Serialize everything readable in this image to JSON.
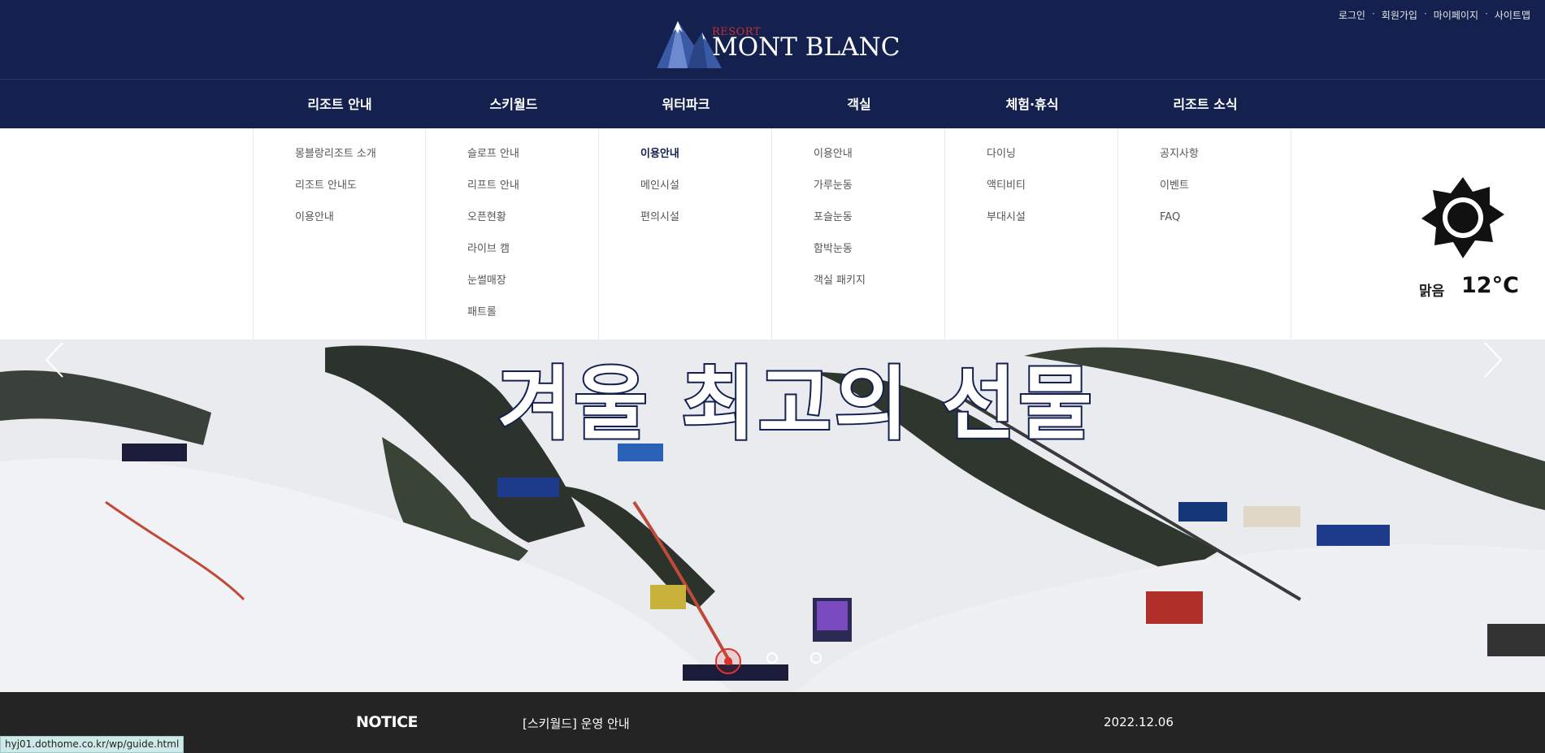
{
  "util_links": [
    "로그인",
    "회원가입",
    "마이페이지",
    "사이트맵"
  ],
  "logo": {
    "small": "RESORT",
    "big": "MONT BLANC",
    "alt_label": "Resort Mont Blanc"
  },
  "gnb": [
    "리조트 안내",
    "스키월드",
    "워터파크",
    "객실",
    "체험·휴식",
    "리조트 소식"
  ],
  "mega": [
    [
      "몽블랑리조트 소개",
      "리조트 안내도",
      "이용안내"
    ],
    [
      "슬로프 안내",
      "리프트 안내",
      "오픈현황",
      "라이브 캠",
      "눈썰매장",
      "패트롤"
    ],
    [
      "이용안내",
      "메인시설",
      "편의시설"
    ],
    [
      "이용안내",
      "가루눈동",
      "포슬눈동",
      "함박눈동",
      "객실 패키지"
    ],
    [
      "다이닝",
      "액티비티",
      "부대시설"
    ],
    [
      "공지사항",
      "이벤트",
      "FAQ"
    ]
  ],
  "active_menu": "waterpark.이용안내",
  "weather": {
    "condition": "맑음",
    "temp": "12°C",
    "icon": "sun-icon"
  },
  "hero": {
    "title": "겨울 최고의 선물",
    "slides": 3,
    "active_slide": 1
  },
  "notice": {
    "heading": "NOTICE",
    "text": "[스키월드] 운영 안내",
    "date": "2022.12.06"
  },
  "status_url": "hyj01.dothome.co.kr/wp/guide.html",
  "colors": {
    "navy": "#14214f",
    "accent_red": "#d9342b",
    "notice_bg": "#242424"
  }
}
